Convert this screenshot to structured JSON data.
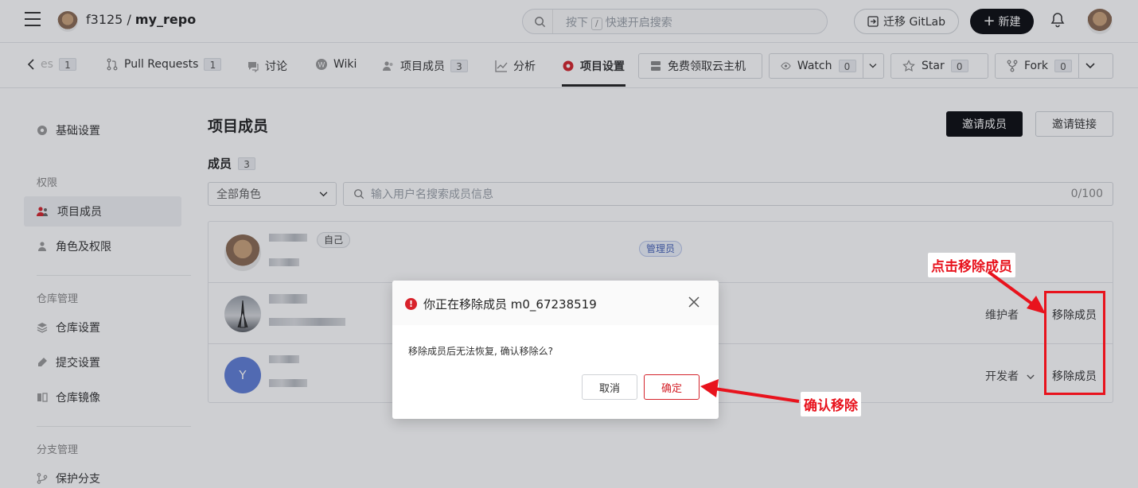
{
  "header": {
    "repo_owner": "f3125",
    "repo_sep": " / ",
    "repo_name": "my_repo",
    "search_prefix": "按下",
    "search_key": "/",
    "search_suffix": "快速开启搜索",
    "migrate_label": "迁移 GitLab",
    "new_label": "新建"
  },
  "nav": {
    "issues_label": "es",
    "issues_count": "1",
    "pr_label": "Pull Requests",
    "pr_count": "1",
    "discuss_label": "讨论",
    "wiki_label": "Wiki",
    "members_label": "项目成员",
    "members_count": "3",
    "analysis_label": "分析",
    "settings_label": "项目设置",
    "cloud_label": "免费领取云主机",
    "watch_label": "Watch",
    "watch_count": "0",
    "star_label": "Star",
    "star_count": "0",
    "fork_label": "Fork",
    "fork_count": "0"
  },
  "sidebar": {
    "basic": "基础设置",
    "group_permission": "权限",
    "members": "项目成员",
    "roles": "角色及权限",
    "group_repo": "仓库管理",
    "repo_settings": "仓库设置",
    "commit_settings": "提交设置",
    "repo_mirror": "仓库镜像",
    "group_branch": "分支管理",
    "protect_branch": "保护分支"
  },
  "main": {
    "title": "项目成员",
    "invite_label": "邀请成员",
    "invite_link_label": "邀请链接",
    "members_heading": "成员",
    "members_count": "3",
    "role_filter": "全部角色",
    "search_placeholder": "输入用户名搜索成员信息",
    "search_count": "0/100",
    "rows": [
      {
        "tag": "自己",
        "role": "管理员"
      },
      {
        "role": "维护者",
        "action": "移除成员"
      },
      {
        "avatar_letter": "Y",
        "role": "开发者",
        "action": "移除成员"
      }
    ]
  },
  "dialog": {
    "title": "你正在移除成员 m0_67238519",
    "message": "移除成员后无法恢复, 确认移除么?",
    "cancel": "取消",
    "confirm": "确定"
  },
  "annotations": {
    "click_remove": "点击移除成员",
    "confirm_remove": "确认移除"
  },
  "colors": {
    "annotation_red": "#e8131d",
    "danger": "#d4232b",
    "primary_dark": "#0b0c10"
  }
}
